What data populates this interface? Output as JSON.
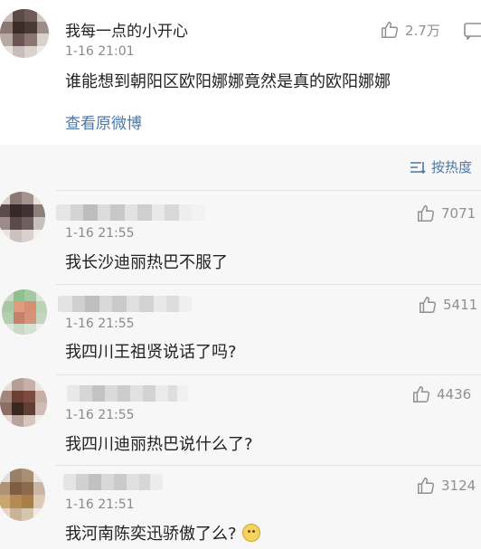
{
  "post": {
    "username": "我每一点的小开心",
    "time": "1-16 21:01",
    "likes": "2.7万",
    "content": "谁能想到朝阳区欧阳娜娜竟然是真的欧阳娜娜",
    "view_original": "查看原微博"
  },
  "sort": {
    "label": "按热度"
  },
  "comments": [
    {
      "time": "1-16 21:55",
      "likes": "7071",
      "content": "我长沙迪丽热巴不服了"
    },
    {
      "time": "1-16 21:55",
      "likes": "5411",
      "content": "我四川王祖贤说话了吗?"
    },
    {
      "time": "1-16 21:55",
      "likes": "4436",
      "content": "我四川迪丽热巴说什么了?"
    },
    {
      "time": "1-16 21:51",
      "likes": "3124",
      "content": "我河南陈奕迅骄傲了么?"
    }
  ],
  "icons": [
    "thumbs-up-icon",
    "more-icon",
    "sort-icon",
    "emoji-icon"
  ],
  "colors": {
    "link": "#4d77a8",
    "meta": "#8a8a8a",
    "background": "#f7f7f7"
  }
}
